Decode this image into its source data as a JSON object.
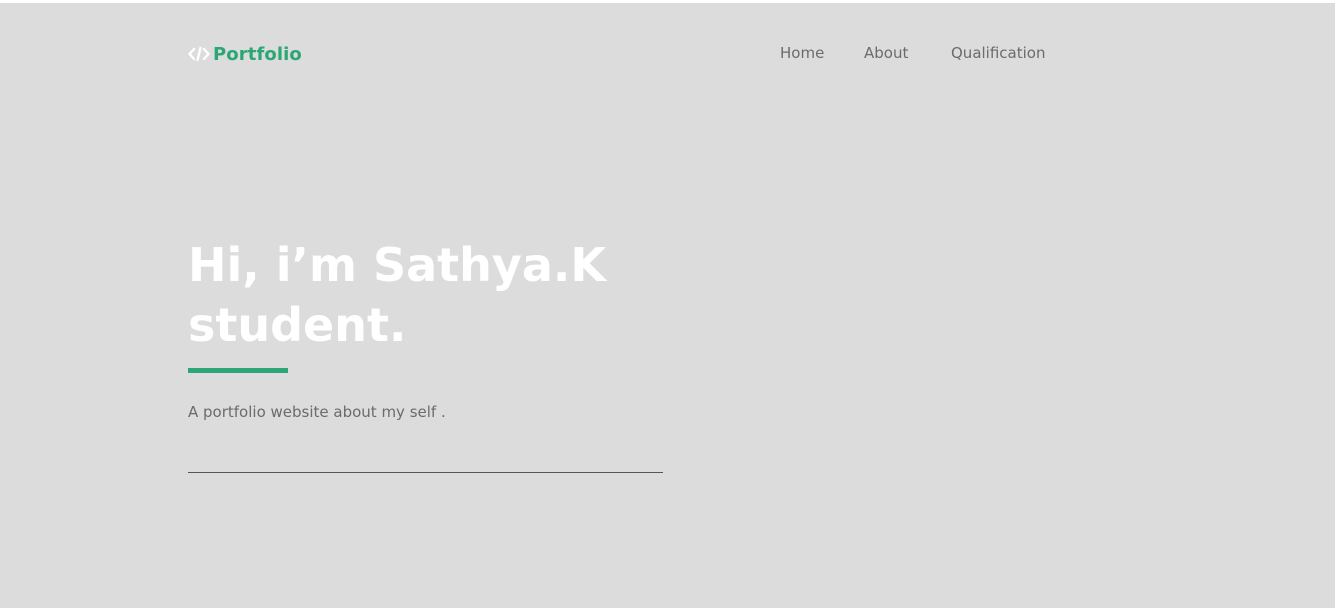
{
  "header": {
    "logo_text": "Portfolio",
    "logo_icon": "code-brackets-icon",
    "nav": {
      "home": "Home",
      "about": "About",
      "qualification": "Qualification"
    }
  },
  "hero": {
    "title_line1": "Hi, i’m Sathya.K",
    "title_line2": "student.",
    "subtitle": "A portfolio website about my self ."
  },
  "colors": {
    "background": "#dcdcdc",
    "accent": "#2aa774",
    "title": "#ffffff",
    "muted_text": "#6b6b6b"
  }
}
